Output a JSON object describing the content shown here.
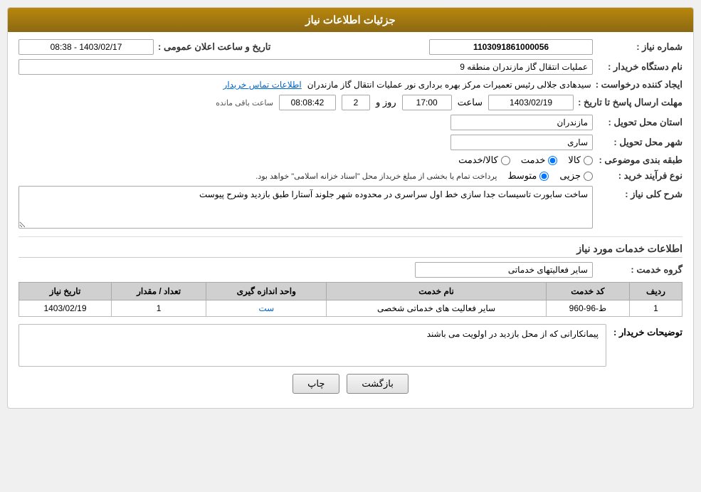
{
  "header": {
    "title": "جزئیات اطلاعات نیاز"
  },
  "fields": {
    "need_number_label": "شماره نیاز :",
    "need_number_value": "1103091861000056",
    "buyer_station_label": "نام دستگاه خریدار :",
    "buyer_station_value": "عملیات انتقال گاز مازندران منطقه 9",
    "request_creator_label": "ایجاد کننده درخواست :",
    "request_creator_value": "سیدهادی جلالی رئیس تعمیرات مرکز بهره برداری نور عملیات انتقال گاز مازندران",
    "contact_link": "اطلاعات تماس خریدار",
    "send_date_label": "مهلت ارسال پاسخ تا تاریخ :",
    "send_date_value": "1403/02/19",
    "send_time_label": "ساعت",
    "send_time_value": "17:00",
    "send_days_label": "روز و",
    "send_days_value": "2",
    "time_remain_value": "08:08:42",
    "time_remain_label": "ساعت باقی مانده",
    "province_label": "استان محل تحویل :",
    "province_value": "مازندران",
    "city_label": "شهر محل تحویل :",
    "city_value": "ساری",
    "category_label": "طبقه بندی موضوعی :",
    "category_options": [
      {
        "label": "کالا",
        "value": "kala"
      },
      {
        "label": "خدمت",
        "value": "khedmat"
      },
      {
        "label": "کالا/خدمت",
        "value": "kala_khedmat"
      }
    ],
    "category_selected": "khedmat",
    "purchase_type_label": "نوع فرآیند خرید :",
    "purchase_options": [
      {
        "label": "جزیی",
        "value": "jozi"
      },
      {
        "label": "متوسط",
        "value": "motevaset"
      }
    ],
    "purchase_selected": "motevaset",
    "purchase_note": "پرداخت تمام یا بخشی از مبلغ خریداز محل \"اسناد خزانه اسلامی\" خواهد بود.",
    "announce_label": "تاریخ و ساعت اعلان عمومی :",
    "announce_value": "1403/02/17 - 08:38",
    "general_desc_label": "شرح کلی نیاز :",
    "general_desc_value": "ساخت سابورت تاسیسات جدا سازی خط اول سراسری در محدوده شهر جلوند آستارا طبق بازدید وشرح پیوست"
  },
  "services_section": {
    "title": "اطلاعات خدمات مورد نیاز",
    "service_group_label": "گروه خدمت :",
    "service_group_value": "سایر فعالیتهای خدماتی",
    "table": {
      "columns": [
        "ردیف",
        "کد خدمت",
        "نام خدمت",
        "واحد اندازه گیری",
        "تعداد / مقدار",
        "تاریخ نیاز"
      ],
      "rows": [
        {
          "row_num": "1",
          "service_code": "ط-96-960",
          "service_name": "سایر فعالیت های خدماتی شخصی",
          "unit": "ست",
          "quantity": "1",
          "date": "1403/02/19"
        }
      ]
    }
  },
  "buyer_notes_section": {
    "label": "توضیحات خریدار :",
    "value": "پیمانکارانی که از محل بازدید در اولویت می باشند"
  },
  "buttons": {
    "print_label": "چاپ",
    "back_label": "بازگشت"
  }
}
